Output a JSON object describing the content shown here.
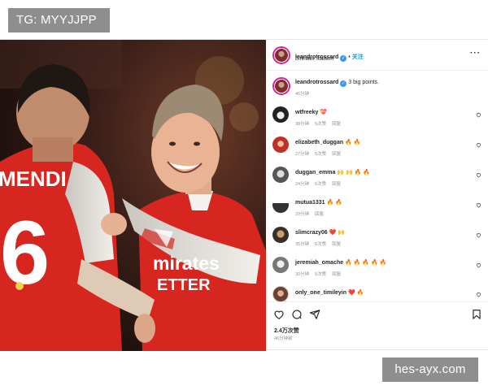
{
  "watermarks": {
    "top": "TG: MYYJJPP",
    "bottom": "hes-ayx.com"
  },
  "photo": {
    "left_shirt_name": "MENDI",
    "left_shirt_number": "6",
    "sponsor_line1": "mirates",
    "sponsor_line2": "ETTER"
  },
  "post": {
    "author": "leandrotrossard",
    "follow_label": "关注",
    "separator": "•",
    "location": "Emirates Stadium",
    "more_icon": "more-horizontal-icon",
    "caption": {
      "username": "leandrotrossard",
      "text": "3 big points.",
      "time": "46分钟"
    },
    "comments": [
      {
        "username": "wtfreeky",
        "text": "💝",
        "time": "38分钟",
        "likes": "5次赞",
        "reply": "回复"
      },
      {
        "username": "elizabeth_duggan",
        "text": "🔥 🔥",
        "time": "27分钟",
        "likes": "5次赞",
        "reply": "回复"
      },
      {
        "username": "duggan_emma",
        "text": "🙌 🙌 🔥 🔥",
        "time": "24分钟",
        "likes": "6次赞",
        "reply": "回复"
      },
      {
        "username": "mutua1331",
        "text": "🔥 🔥",
        "time": "29分钟",
        "likes": "",
        "reply": "回复"
      },
      {
        "username": "slimcrazy06",
        "text": "❤️ 🙌",
        "time": "35分钟",
        "likes": "5次赞",
        "reply": "回复"
      },
      {
        "username": "jeremiah_omache",
        "text": "🔥 🔥 🔥 🔥 🔥",
        "time": "30分钟",
        "likes": "5次赞",
        "reply": "回复"
      },
      {
        "username": "only_one_timileyin",
        "text": "❤️ 🔥",
        "time": "",
        "likes": "",
        "reply": ""
      }
    ],
    "likes_count": "2.4万次赞",
    "posted_ago": "46分钟前"
  },
  "colors": {
    "verified": "#3897f0",
    "follow": "#0095f6",
    "arsenal_red": "#d8201d",
    "watermark_bg": "#8e8e8e"
  }
}
